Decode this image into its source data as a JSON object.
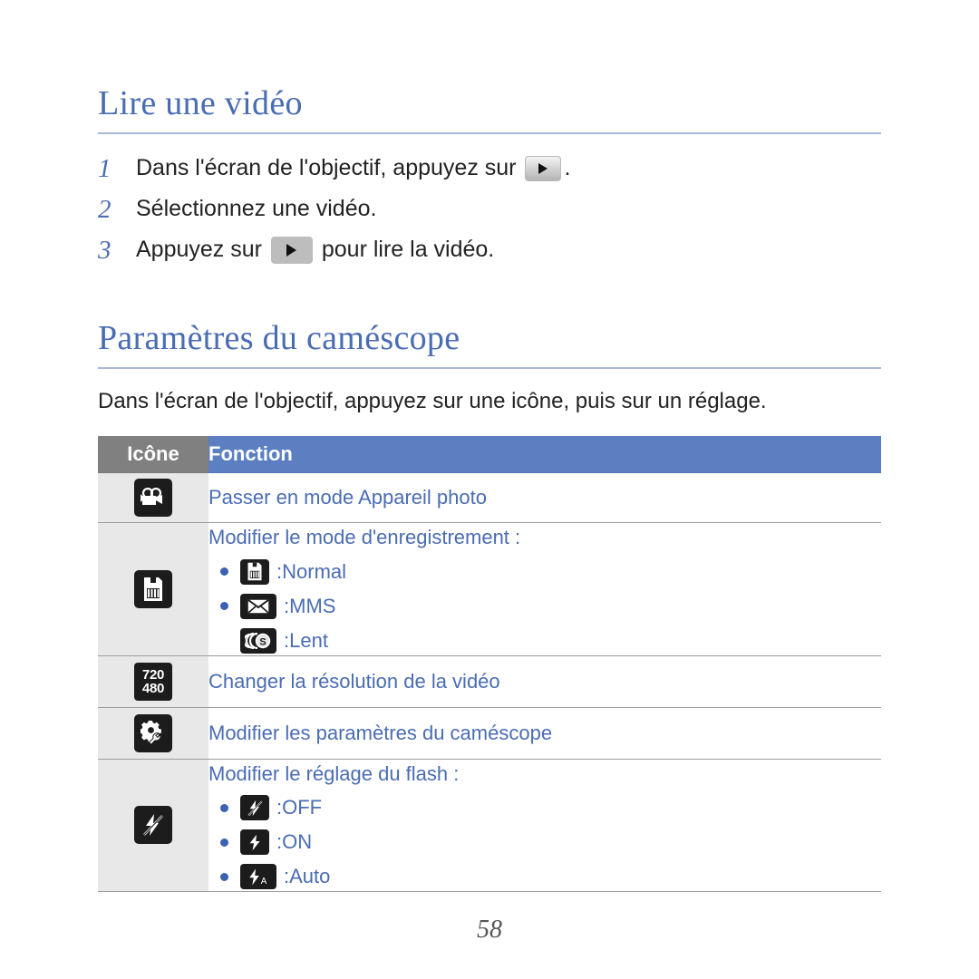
{
  "document": {
    "page_number": "58",
    "accent_blue": "#4a6cb3",
    "header_blue": "#5b7fc0",
    "header_gray": "#808080",
    "icon_cell_gray": "#e8e8e8"
  },
  "section_play_video": {
    "heading": "Lire une vidéo",
    "steps": [
      {
        "number": "1",
        "text_before": "Dans l'écran de l'objectif, appuyez sur ",
        "icon": "play-button-gradient",
        "text_after": "."
      },
      {
        "number": "2",
        "text_before": "Sélectionnez une vidéo.",
        "icon": null,
        "text_after": ""
      },
      {
        "number": "3",
        "text_before": "Appuyez sur ",
        "icon": "play-button-flat",
        "text_after": " pour lire la vidéo."
      }
    ]
  },
  "section_camcorder_settings": {
    "heading": "Paramètres du caméscope",
    "intro": "Dans l'écran de l'objectif, appuyez sur une icône, puis sur un réglage.",
    "table": {
      "headers": {
        "icon": "Icône",
        "function": "Fonction"
      },
      "rows": [
        {
          "icon_name": "camcorder-icon",
          "function": "Passer en mode Appareil photo",
          "sub_items": []
        },
        {
          "icon_name": "recording-mode-icon",
          "function": "Modifier le mode d'enregistrement :",
          "sub_items": [
            {
              "icon_name": "recording-mode-normal-icon",
              "separator": ": ",
              "label": "Normal"
            },
            {
              "icon_name": "mms-envelope-icon",
              "separator": ": ",
              "label": "MMS"
            },
            {
              "icon_name": "slow-motion-icon",
              "separator": ": ",
              "label": "Lent"
            }
          ]
        },
        {
          "icon_name": "resolution-720-480-icon",
          "icon_text_top": "720",
          "icon_text_bottom": "480",
          "function": "Changer la résolution de la vidéo",
          "sub_items": []
        },
        {
          "icon_name": "camcorder-settings-gear-icon",
          "function": "Modifier les paramètres du caméscope",
          "sub_items": []
        },
        {
          "icon_name": "flash-off-icon",
          "function": "Modifier le réglage du flash :",
          "sub_items": [
            {
              "icon_name": "flash-off-icon",
              "separator": ": ",
              "label": "OFF"
            },
            {
              "icon_name": "flash-on-icon",
              "separator": ": ",
              "label": "ON"
            },
            {
              "icon_name": "flash-auto-icon",
              "separator": ": ",
              "label": "Auto"
            }
          ]
        }
      ]
    }
  }
}
